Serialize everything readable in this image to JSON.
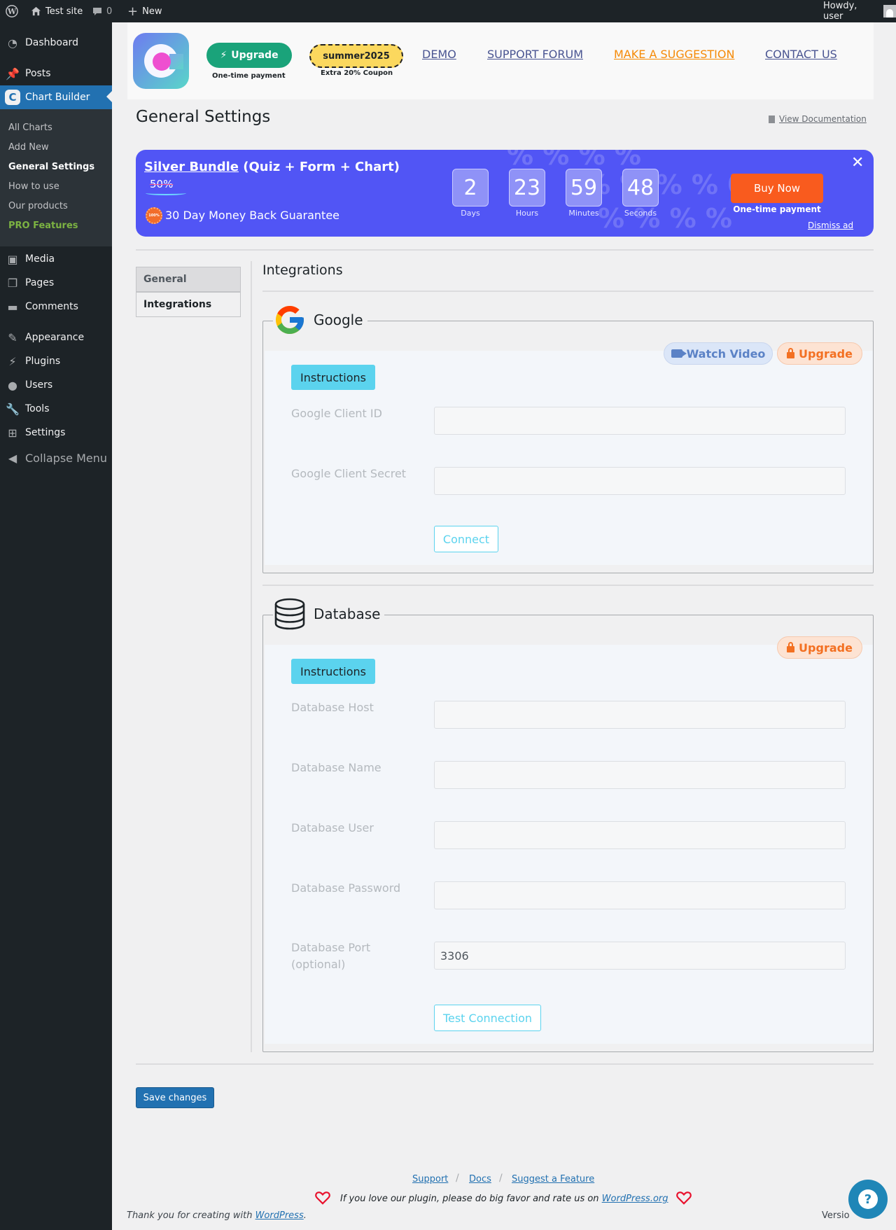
{
  "adminbar": {
    "site_name": "Test site",
    "comments_count": "0",
    "new_label": "New",
    "howdy": "Howdy, user"
  },
  "sidebar": {
    "items": [
      {
        "label": "Dashboard",
        "icon": "dashboard-icon"
      },
      {
        "label": "Posts",
        "icon": "pin-icon"
      },
      {
        "label": "Chart Builder",
        "icon": "chart-builder-logo-icon"
      },
      {
        "label": "Media",
        "icon": "media-icon"
      },
      {
        "label": "Pages",
        "icon": "pages-icon"
      },
      {
        "label": "Comments",
        "icon": "comment-icon"
      },
      {
        "label": "Appearance",
        "icon": "brush-icon"
      },
      {
        "label": "Plugins",
        "icon": "plugin-icon"
      },
      {
        "label": "Users",
        "icon": "user-icon"
      },
      {
        "label": "Tools",
        "icon": "wrench-icon"
      },
      {
        "label": "Settings",
        "icon": "settings-icon"
      }
    ],
    "submenu": [
      "All Charts",
      "Add New",
      "General Settings",
      "How to use",
      "Our products",
      "PRO Features"
    ],
    "collapse_label": "Collapse Menu"
  },
  "header": {
    "upgrade_label": "Upgrade",
    "upgrade_sub": "One-time payment",
    "coupon_code": "summer2025",
    "coupon_sub": "Extra 20% Coupon",
    "links": [
      "DEMO",
      "SUPPORT FORUM",
      "MAKE A SUGGESTION",
      "CONTACT US"
    ]
  },
  "page": {
    "title": "General Settings",
    "doc_link": "View Documentation"
  },
  "promo": {
    "title_link": "Silver Bundle",
    "title_rest": " (Quiz + Form + Chart)",
    "discount": "50%",
    "badge_text": "100%",
    "guarantee": "30 Day Money Back Guarantee",
    "countdown": [
      {
        "value": "2",
        "label": "Days"
      },
      {
        "value": "23",
        "label": "Hours"
      },
      {
        "value": "59",
        "label": "Minutes"
      },
      {
        "value": "48",
        "label": "Seconds"
      }
    ],
    "buy_label": "Buy Now",
    "buy_sub": "One-time payment",
    "dismiss_label": "Dismiss ad",
    "close_glyph": "✕",
    "colors": {
      "background": "#5155f5",
      "buy_button": "#f95b1e"
    }
  },
  "tabs": [
    "General",
    "Integrations"
  ],
  "section_title": "Integrations",
  "google": {
    "legend": "Google",
    "watch_video": "Watch Video",
    "upgrade": "Upgrade",
    "instructions": "Instructions",
    "fields": [
      {
        "label": "Google Client ID",
        "value": ""
      },
      {
        "label": "Google Client Secret",
        "value": ""
      }
    ],
    "connect_label": "Connect"
  },
  "database": {
    "legend": "Database",
    "upgrade": "Upgrade",
    "instructions": "Instructions",
    "fields": [
      {
        "label": "Database Host",
        "value": ""
      },
      {
        "label": "Database Name",
        "value": ""
      },
      {
        "label": "Database User",
        "value": ""
      },
      {
        "label": "Database Password",
        "value": ""
      },
      {
        "label": "Database Port (optional)",
        "value": "3306"
      }
    ],
    "test_label": "Test Connection"
  },
  "save_label": "Save changes",
  "footer": {
    "links": [
      "Support",
      "Docs",
      "Suggest a Feature"
    ],
    "rate_text": "If you love our plugin, please do big favor and rate us on ",
    "rate_link": "WordPress.org",
    "thanks_text": "Thank you for creating with ",
    "thanks_link": "WordPress",
    "thanks_end": ".",
    "version": "Versio",
    "help_glyph": "?"
  }
}
